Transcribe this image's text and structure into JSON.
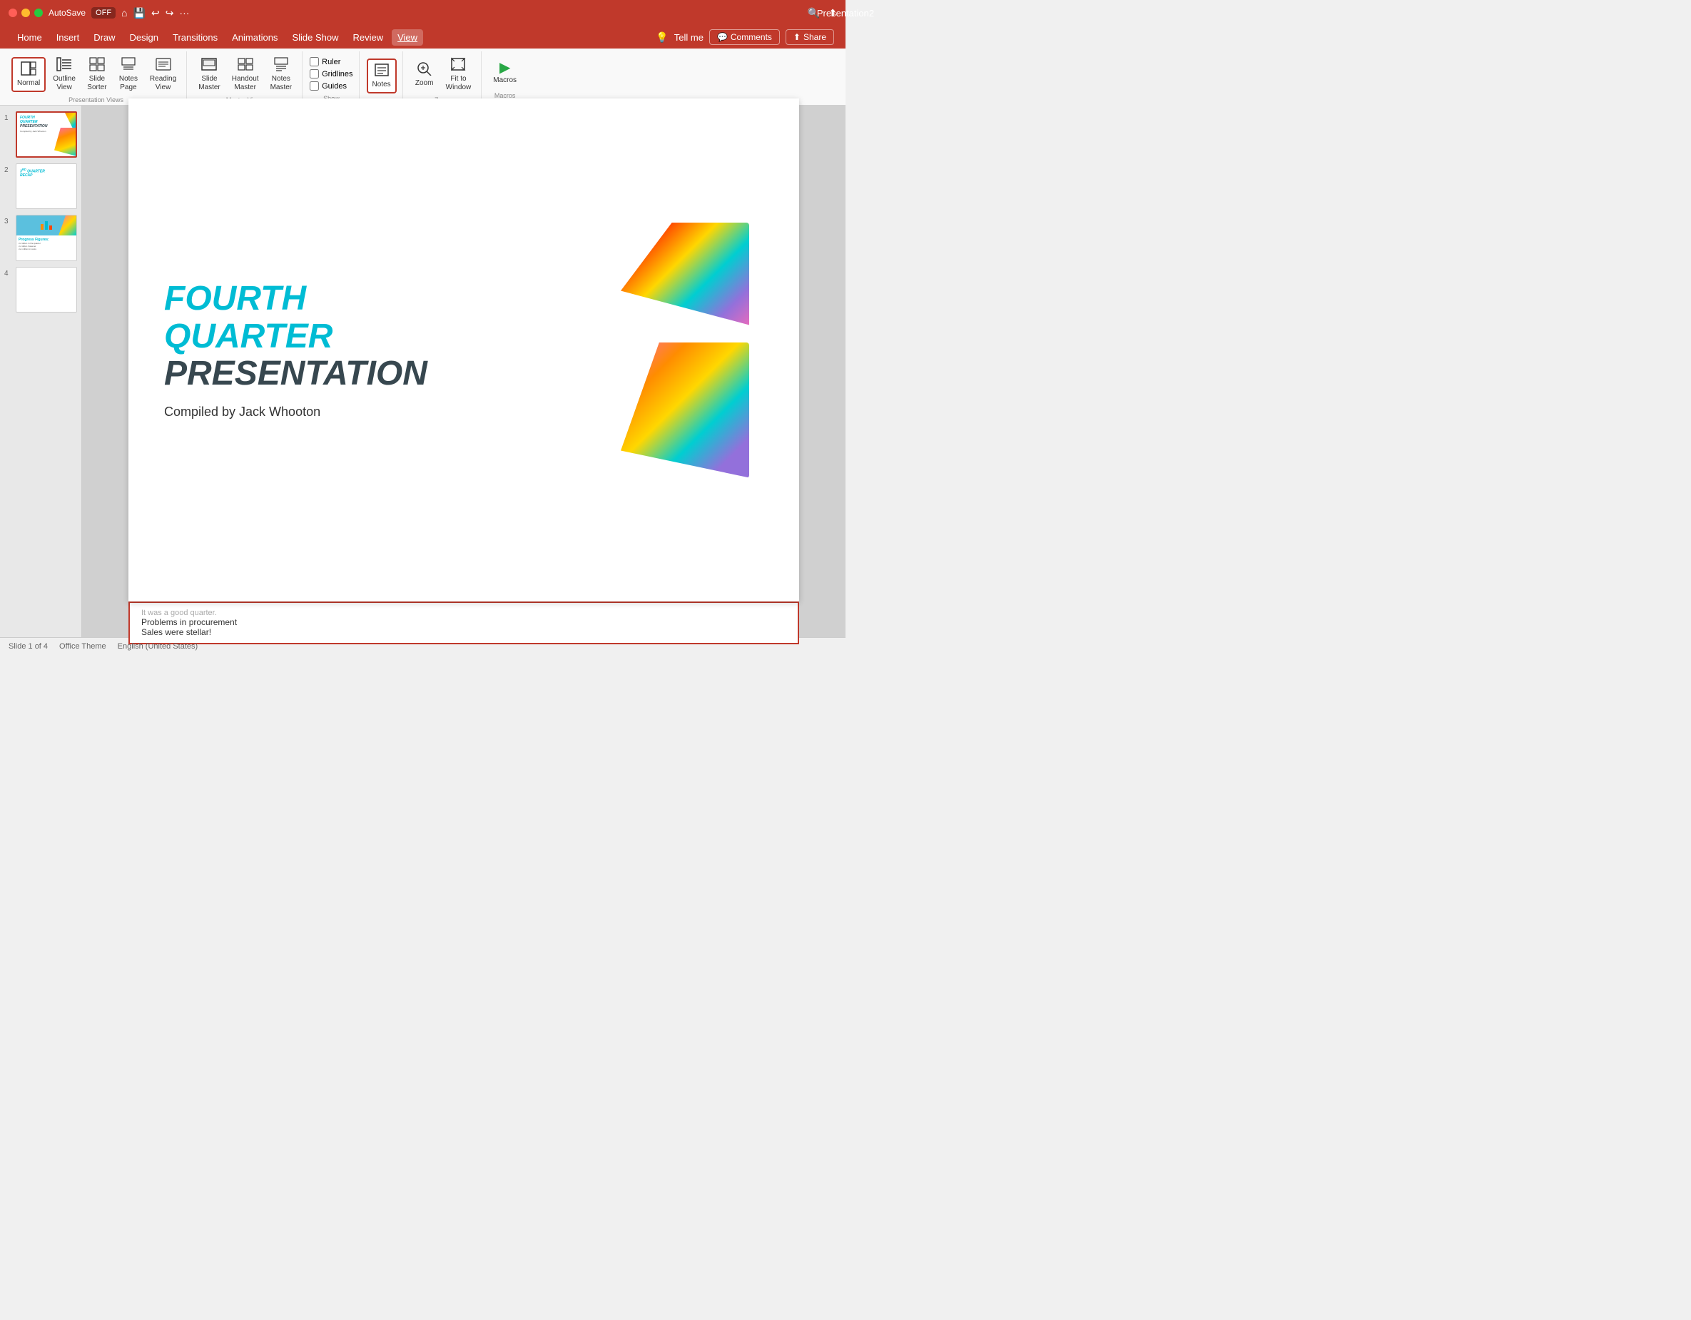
{
  "titleBar": {
    "appName": "AutoSave",
    "autosaveLabel": "OFF",
    "title": "Presentation2",
    "homeIcon": "⌂",
    "saveIcon": "💾",
    "undoIcon": "↩",
    "redoIcon": "↪",
    "moreIcon": "···",
    "searchIcon": "🔍",
    "shareIcon": "⬆"
  },
  "menuBar": {
    "items": [
      "Home",
      "Insert",
      "Draw",
      "Design",
      "Transitions",
      "Animations",
      "Slide Show",
      "Review",
      "View"
    ],
    "activeItem": "View",
    "extras": [
      "💡",
      "Tell me"
    ],
    "commentsBtn": "Comments",
    "shareBtn": "Share"
  },
  "ribbon": {
    "presentationViews": {
      "label": "Presentation Views",
      "items": [
        {
          "id": "normal",
          "icon": "▤",
          "label": "Normal",
          "active": true
        },
        {
          "id": "outline-view",
          "icon": "☰",
          "label": "Outline View",
          "active": false
        },
        {
          "id": "slide-sorter",
          "icon": "⊞",
          "label": "Slide Sorter",
          "active": false
        },
        {
          "id": "notes-page",
          "icon": "📄",
          "label": "Notes Page",
          "active": false
        },
        {
          "id": "reading-view",
          "icon": "📖",
          "label": "Reading View",
          "active": false
        }
      ]
    },
    "masterViews": {
      "label": "Master Views",
      "items": [
        {
          "id": "slide-master",
          "icon": "▤",
          "label": "Slide Master",
          "active": false
        },
        {
          "id": "handout-master",
          "icon": "⊡",
          "label": "Handout Master",
          "active": false
        },
        {
          "id": "notes-master",
          "icon": "📝",
          "label": "Notes Master",
          "active": false
        }
      ]
    },
    "show": {
      "label": "Show",
      "items": [
        {
          "id": "ruler",
          "label": "Ruler",
          "checked": false
        },
        {
          "id": "gridlines",
          "label": "Gridlines",
          "checked": false
        },
        {
          "id": "guides",
          "label": "Guides",
          "checked": false
        }
      ]
    },
    "notes": {
      "icon": "📋",
      "label": "Notes",
      "active": true
    },
    "zoom": {
      "icon": "🔍",
      "label": "Zoom"
    },
    "fitToWindow": {
      "icon": "⬜",
      "label": "Fit to Window"
    },
    "macros": {
      "icon": "▶",
      "label": "Macros"
    }
  },
  "slides": [
    {
      "number": "1",
      "selected": true,
      "content": {
        "title": "FOURTH QUARTER PRESENTATION",
        "subtitle": "Compiled by Jack Whooton"
      }
    },
    {
      "number": "2",
      "selected": false,
      "content": {
        "title": "3RD QUARTER RECAP"
      }
    },
    {
      "number": "3",
      "selected": false,
      "content": {
        "title": "Progress Figures"
      }
    },
    {
      "number": "4",
      "selected": false,
      "content": {}
    }
  ],
  "mainSlide": {
    "titleLine1": "FOURTH",
    "titleLine2": "QUARTER",
    "titleLine3": "PRESENTATION",
    "subtitle": "Compiled by Jack Whooton"
  },
  "notes": {
    "line1": "It was a good quarter.",
    "line2": "Problems in procurement",
    "line3": "Sales were stellar!"
  },
  "statusBar": {
    "slideInfo": "Slide 1 of 4",
    "theme": "Office Theme",
    "language": "English (United States)"
  }
}
